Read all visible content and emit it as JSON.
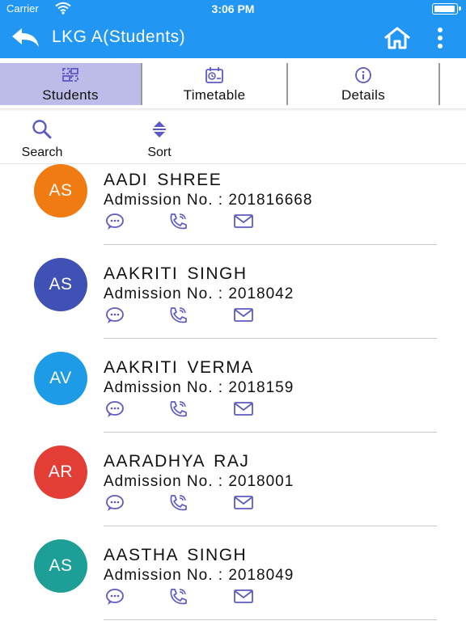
{
  "status_bar": {
    "carrier": "Carrier",
    "time": "3:06 PM"
  },
  "app_bar": {
    "title": "LKG A(Students)"
  },
  "tabs": [
    {
      "label": "Students",
      "icon": "students-icon",
      "active": true
    },
    {
      "label": "Timetable",
      "icon": "timetable-icon",
      "active": false
    },
    {
      "label": "Details",
      "icon": "info-icon",
      "active": false
    }
  ],
  "actions": {
    "search_label": "Search",
    "sort_label": "Sort"
  },
  "students": [
    {
      "initials": "AS",
      "name": "AADI SHREE",
      "admission": "Admission No. : 201816668",
      "avatar_color": "#f07b12"
    },
    {
      "initials": "AS",
      "name": "AAKRITI SINGH",
      "admission": "Admission No. : 2018042",
      "avatar_color": "#3f51b5"
    },
    {
      "initials": "AV",
      "name": "AAKRITI VERMA",
      "admission": "Admission No. : 2018159",
      "avatar_color": "#1e9be6"
    },
    {
      "initials": "AR",
      "name": "AARADHYA RAJ",
      "admission": "Admission No. : 2018001",
      "avatar_color": "#e23e36"
    },
    {
      "initials": "AS",
      "name": "AASTHA SINGH",
      "admission": "Admission No. : 2018049",
      "avatar_color": "#1d9e96"
    }
  ],
  "colors": {
    "primary": "#2196f3",
    "accent_icon": "#5c59c4",
    "active_tab": "#bdbbe7"
  }
}
